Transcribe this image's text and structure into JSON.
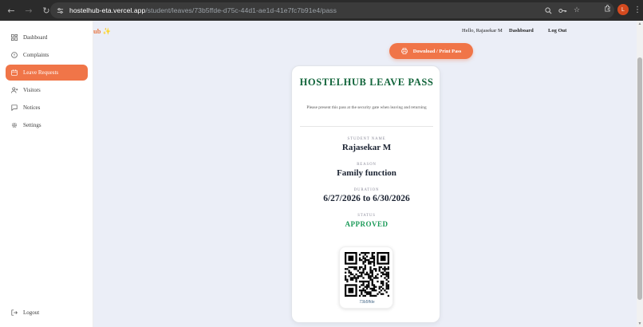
{
  "browser": {
    "url_host": "hostelhub-eta.vercel.app",
    "url_path": "/student/leaves/73b5ffde-d75c-44d1-ae1d-41e7fc7b91e4/pass",
    "profile_initial": "L",
    "icons": [
      "back-arrow-icon",
      "forward-arrow-icon",
      "reload-icon",
      "site-info-icon",
      "zoom-icon",
      "password-key-icon",
      "bookmark-star-icon",
      "extensions-icon",
      "menu-icon"
    ]
  },
  "sidebar": {
    "items": [
      {
        "label": "Dashboard",
        "icon": "grid-icon",
        "active": false
      },
      {
        "label": "Complaints",
        "icon": "alert-circle-icon",
        "active": false
      },
      {
        "label": "Leave Requests",
        "icon": "calendar-icon",
        "active": true
      },
      {
        "label": "Visitors",
        "icon": "user-plus-icon",
        "active": false
      },
      {
        "label": "Notices",
        "icon": "chat-bubble-icon",
        "active": false
      },
      {
        "label": "Settings",
        "icon": "gear-icon",
        "active": false
      }
    ],
    "logout_label": "Logout"
  },
  "header": {
    "brand_partial": "ub",
    "greeting": "Hello, Rajasekar M",
    "dashboard_link": "Dashboard",
    "logout_link": "Log Out"
  },
  "download_button": {
    "label": "Download / Print Pass"
  },
  "pass": {
    "title": "HOSTELHUB LEAVE PASS",
    "subtitle": "Please present this pass at the security gate when leaving and returning",
    "student_label": "STUDENT NAME",
    "student_name": "Rajasekar M",
    "reason_label": "REASON",
    "reason": "Family function",
    "duration_label": "DURATION",
    "duration": "6/27/2026 to 6/30/2026",
    "status_label": "STATUS",
    "status": "APPROVED",
    "qr_caption": "73b5ffde"
  },
  "colors": {
    "accent": "#f07548",
    "title_green": "#11643a",
    "status_green": "#1a9a58",
    "main_bg": "#ebeef7"
  }
}
